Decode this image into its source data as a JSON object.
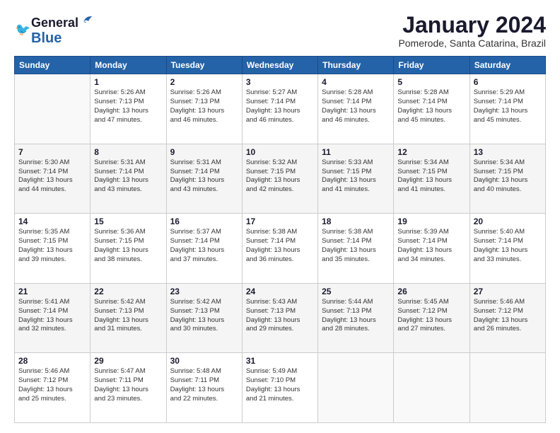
{
  "header": {
    "logo_line1": "General",
    "logo_line2": "Blue",
    "month_title": "January 2024",
    "subtitle": "Pomerode, Santa Catarina, Brazil"
  },
  "weekdays": [
    "Sunday",
    "Monday",
    "Tuesday",
    "Wednesday",
    "Thursday",
    "Friday",
    "Saturday"
  ],
  "weeks": [
    [
      {
        "day": "",
        "info": ""
      },
      {
        "day": "1",
        "info": "Sunrise: 5:26 AM\nSunset: 7:13 PM\nDaylight: 13 hours\nand 47 minutes."
      },
      {
        "day": "2",
        "info": "Sunrise: 5:26 AM\nSunset: 7:13 PM\nDaylight: 13 hours\nand 46 minutes."
      },
      {
        "day": "3",
        "info": "Sunrise: 5:27 AM\nSunset: 7:14 PM\nDaylight: 13 hours\nand 46 minutes."
      },
      {
        "day": "4",
        "info": "Sunrise: 5:28 AM\nSunset: 7:14 PM\nDaylight: 13 hours\nand 46 minutes."
      },
      {
        "day": "5",
        "info": "Sunrise: 5:28 AM\nSunset: 7:14 PM\nDaylight: 13 hours\nand 45 minutes."
      },
      {
        "day": "6",
        "info": "Sunrise: 5:29 AM\nSunset: 7:14 PM\nDaylight: 13 hours\nand 45 minutes."
      }
    ],
    [
      {
        "day": "7",
        "info": "Sunrise: 5:30 AM\nSunset: 7:14 PM\nDaylight: 13 hours\nand 44 minutes."
      },
      {
        "day": "8",
        "info": "Sunrise: 5:31 AM\nSunset: 7:14 PM\nDaylight: 13 hours\nand 43 minutes."
      },
      {
        "day": "9",
        "info": "Sunrise: 5:31 AM\nSunset: 7:14 PM\nDaylight: 13 hours\nand 43 minutes."
      },
      {
        "day": "10",
        "info": "Sunrise: 5:32 AM\nSunset: 7:15 PM\nDaylight: 13 hours\nand 42 minutes."
      },
      {
        "day": "11",
        "info": "Sunrise: 5:33 AM\nSunset: 7:15 PM\nDaylight: 13 hours\nand 41 minutes."
      },
      {
        "day": "12",
        "info": "Sunrise: 5:34 AM\nSunset: 7:15 PM\nDaylight: 13 hours\nand 41 minutes."
      },
      {
        "day": "13",
        "info": "Sunrise: 5:34 AM\nSunset: 7:15 PM\nDaylight: 13 hours\nand 40 minutes."
      }
    ],
    [
      {
        "day": "14",
        "info": "Sunrise: 5:35 AM\nSunset: 7:15 PM\nDaylight: 13 hours\nand 39 minutes."
      },
      {
        "day": "15",
        "info": "Sunrise: 5:36 AM\nSunset: 7:15 PM\nDaylight: 13 hours\nand 38 minutes."
      },
      {
        "day": "16",
        "info": "Sunrise: 5:37 AM\nSunset: 7:14 PM\nDaylight: 13 hours\nand 37 minutes."
      },
      {
        "day": "17",
        "info": "Sunrise: 5:38 AM\nSunset: 7:14 PM\nDaylight: 13 hours\nand 36 minutes."
      },
      {
        "day": "18",
        "info": "Sunrise: 5:38 AM\nSunset: 7:14 PM\nDaylight: 13 hours\nand 35 minutes."
      },
      {
        "day": "19",
        "info": "Sunrise: 5:39 AM\nSunset: 7:14 PM\nDaylight: 13 hours\nand 34 minutes."
      },
      {
        "day": "20",
        "info": "Sunrise: 5:40 AM\nSunset: 7:14 PM\nDaylight: 13 hours\nand 33 minutes."
      }
    ],
    [
      {
        "day": "21",
        "info": "Sunrise: 5:41 AM\nSunset: 7:14 PM\nDaylight: 13 hours\nand 32 minutes."
      },
      {
        "day": "22",
        "info": "Sunrise: 5:42 AM\nSunset: 7:13 PM\nDaylight: 13 hours\nand 31 minutes."
      },
      {
        "day": "23",
        "info": "Sunrise: 5:42 AM\nSunset: 7:13 PM\nDaylight: 13 hours\nand 30 minutes."
      },
      {
        "day": "24",
        "info": "Sunrise: 5:43 AM\nSunset: 7:13 PM\nDaylight: 13 hours\nand 29 minutes."
      },
      {
        "day": "25",
        "info": "Sunrise: 5:44 AM\nSunset: 7:13 PM\nDaylight: 13 hours\nand 28 minutes."
      },
      {
        "day": "26",
        "info": "Sunrise: 5:45 AM\nSunset: 7:12 PM\nDaylight: 13 hours\nand 27 minutes."
      },
      {
        "day": "27",
        "info": "Sunrise: 5:46 AM\nSunset: 7:12 PM\nDaylight: 13 hours\nand 26 minutes."
      }
    ],
    [
      {
        "day": "28",
        "info": "Sunrise: 5:46 AM\nSunset: 7:12 PM\nDaylight: 13 hours\nand 25 minutes."
      },
      {
        "day": "29",
        "info": "Sunrise: 5:47 AM\nSunset: 7:11 PM\nDaylight: 13 hours\nand 23 minutes."
      },
      {
        "day": "30",
        "info": "Sunrise: 5:48 AM\nSunset: 7:11 PM\nDaylight: 13 hours\nand 22 minutes."
      },
      {
        "day": "31",
        "info": "Sunrise: 5:49 AM\nSunset: 7:10 PM\nDaylight: 13 hours\nand 21 minutes."
      },
      {
        "day": "",
        "info": ""
      },
      {
        "day": "",
        "info": ""
      },
      {
        "day": "",
        "info": ""
      }
    ]
  ]
}
